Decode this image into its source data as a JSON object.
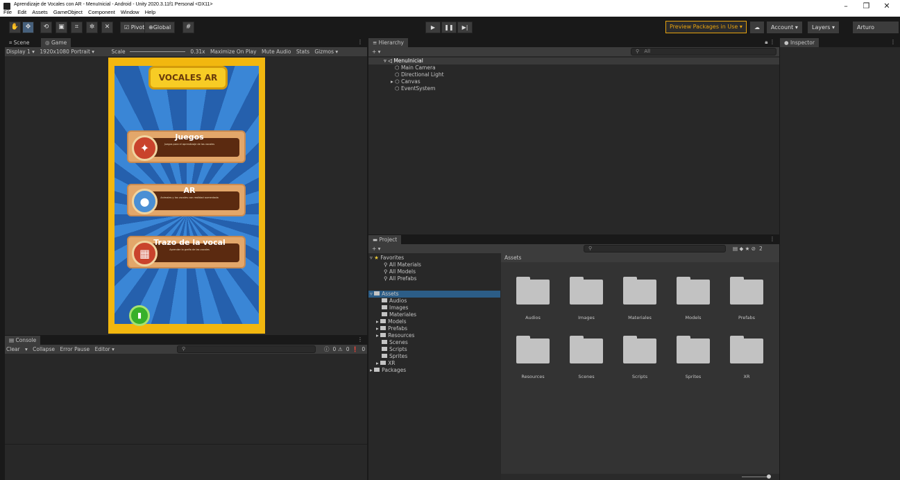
{
  "window": {
    "title": "Aprendizaje de Vocales con AR - MenuInicial - Android - Unity 2020.3.11f1 Personal <DX11>",
    "menu": [
      "File",
      "Edit",
      "Assets",
      "GameObject",
      "Component",
      "Window",
      "Help"
    ],
    "controls": [
      "–",
      "❐",
      "✕"
    ]
  },
  "toolbar": {
    "pivot": "Pivot",
    "global": "Global",
    "preview_packages": "Preview Packages in Use ▾",
    "account": "Account ▾",
    "layers": "Layers ▾",
    "layout": "Arturo",
    "accent": "#e8a30e"
  },
  "game_panel": {
    "tabs": [
      "Scene",
      "Game"
    ],
    "display": "Display 1 ▾",
    "resolution": "1920x1080 Portrait ▾",
    "scale_label": "Scale",
    "scale_value": "0.31x",
    "maximize": "Maximize On Play",
    "mute": "Mute Audio",
    "stats": "Stats",
    "gizmos": "Gizmos ▾"
  },
  "game_screen": {
    "title": "VOCALES AR",
    "buttons": [
      {
        "label": "Juegos",
        "sub": "Juegos para el aprendizaje de las vocales",
        "icon": "controller-icon",
        "color": "#c9432c"
      },
      {
        "label": "AR",
        "sub": "Animales y las vocales con realidad aumentada",
        "icon": "elephant-icon",
        "color": "#4b8fd4"
      },
      {
        "label": "Trazo de la vocal",
        "sub": "Aprender la grafia de las vocales",
        "icon": "grid-icon",
        "color": "#c9432c"
      }
    ],
    "exit_icon": "▮"
  },
  "hierarchy": {
    "tab": "Hierarchy",
    "search": "All",
    "scene": "MenuInicial",
    "items": [
      "Main Camera",
      "Directional Light",
      "Canvas",
      "EventSystem"
    ]
  },
  "inspector": {
    "tab": "Inspector"
  },
  "project": {
    "tab": "Project",
    "favorites": "Favorites",
    "fav_items": [
      "All Materials",
      "All Models",
      "All Prefabs"
    ],
    "assets_root": "Assets",
    "asset_tree": [
      "Audios",
      "Images",
      "Materiales",
      "Models",
      "Prefabs",
      "Resources",
      "Scenes",
      "Scripts",
      "Sprites",
      "XR"
    ],
    "packages": "Packages",
    "breadcrumb": "Assets",
    "folders": [
      "Audios",
      "Images",
      "Materiales",
      "Models",
      "Prefabs",
      "Resources",
      "Scenes",
      "Scripts",
      "Sprites",
      "XR"
    ],
    "hidden_count": "2"
  },
  "console": {
    "tab": "Console",
    "clear": "Clear",
    "collapse": "Collapse",
    "error_pause": "Error Pause",
    "editor": "Editor ▾",
    "info_count": "0",
    "warn_count": "0",
    "error_count": "0"
  }
}
